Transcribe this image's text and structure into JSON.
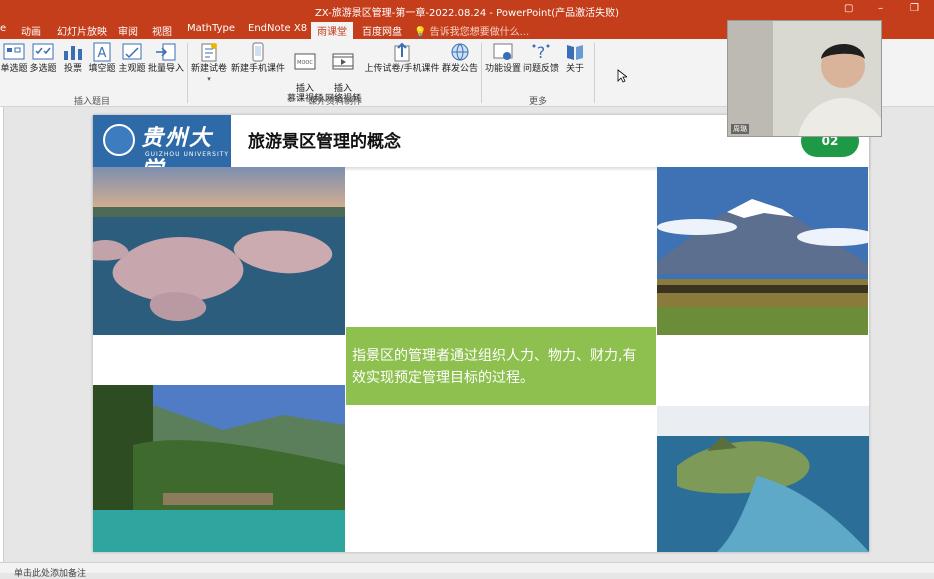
{
  "window": {
    "title": "ZX-旅游景区管理-第一章-2022.08.24 - PowerPoint(产品激活失败)",
    "min_icon": "minimize-icon",
    "restore_icon": "restore-icon"
  },
  "tabs": [
    {
      "label": "e"
    },
    {
      "label": "动画"
    },
    {
      "label": "幻灯片放映"
    },
    {
      "label": "审阅"
    },
    {
      "label": "视图"
    },
    {
      "label": "MathType"
    },
    {
      "label": "EndNote X8"
    },
    {
      "label": "雨课堂",
      "active": true
    },
    {
      "label": "百度网盘"
    }
  ],
  "tell_me": "告诉我您想要做什么...",
  "ribbon": {
    "buttons": [
      {
        "label": "单选题",
        "icon": "single-choice-icon"
      },
      {
        "label": "多选题",
        "icon": "multi-choice-icon"
      },
      {
        "label": "投票",
        "icon": "vote-icon"
      },
      {
        "label": "填空题",
        "icon": "fill-blank-icon"
      },
      {
        "label": "主观题",
        "icon": "subjective-icon"
      },
      {
        "label": "批量导入",
        "icon": "batch-import-icon"
      },
      {
        "label": "新建试卷",
        "icon": "new-exam-icon"
      },
      {
        "label": "新建手机课件",
        "icon": "new-mobile-courseware-icon"
      },
      {
        "label": "插入\n慕课视频",
        "icon": "mooc-video-icon"
      },
      {
        "label": "插入\n网络视频",
        "icon": "web-video-icon"
      },
      {
        "label": "上传试卷/手机课件",
        "icon": "upload-icon"
      },
      {
        "label": "群发公告",
        "icon": "announce-icon"
      },
      {
        "label": "功能设置",
        "icon": "settings-icon"
      },
      {
        "label": "问题反馈",
        "icon": "feedback-icon"
      },
      {
        "label": "关于",
        "icon": "about-icon"
      }
    ],
    "groups": [
      "插入题目",
      "课外资料制作",
      "更多"
    ]
  },
  "slide": {
    "logo_cn": "贵州大学",
    "logo_en": "GUIZHOU UNIVERSITY",
    "title": "旅游景区管理的概念",
    "badge": "02",
    "definition": "指景区的管理者通过组织人力、物力、财力,有效实现预定管理目标的过程。"
  },
  "notes_placeholder": "单击此处添加备注",
  "webcam": {
    "name": "周璐"
  },
  "colors": {
    "accent": "#c43e1c",
    "logo_blue": "#2f6aa8",
    "badge_green": "#1e9a46",
    "text_green": "#8dc04f"
  }
}
